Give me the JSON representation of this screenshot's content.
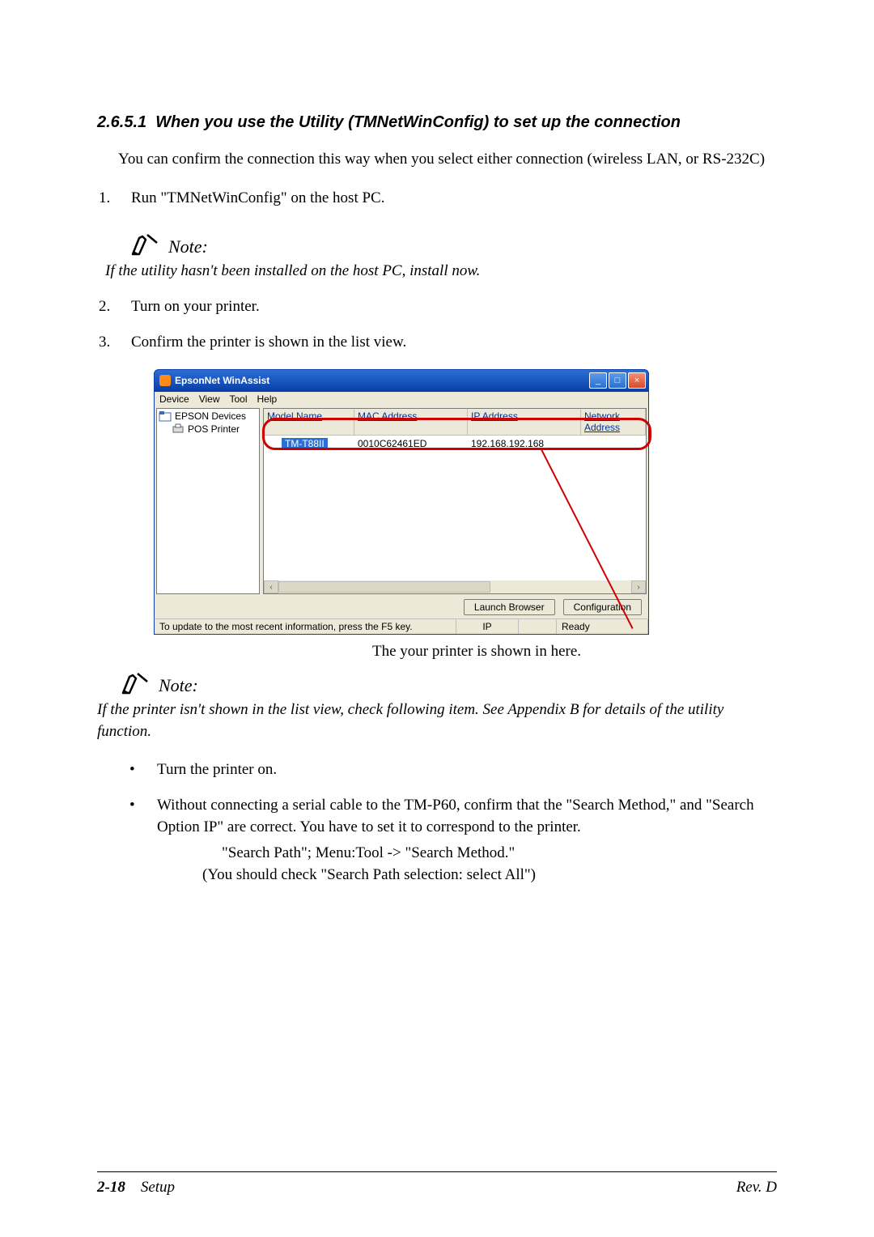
{
  "section": {
    "number": "2.6.5.1",
    "title": "When you use the Utility (TMNetWinConfig) to set up the connection"
  },
  "intro": "You can confirm  the connection this way when you select either connection (wireless LAN, or RS-232C)",
  "steps": {
    "s1": {
      "num": "1.",
      "text": "Run  \"TMNetWinConfig\" on the host PC."
    },
    "s2": {
      "num": "2.",
      "text": "Turn on your printer."
    },
    "s3": {
      "num": "3.",
      "text": "Confirm the printer is shown in the list view."
    }
  },
  "note1": {
    "label": "Note:",
    "text": "If the utility hasn't been installed on the host PC, install now."
  },
  "screenshot": {
    "title": "EpsonNet WinAssist",
    "menu": {
      "device": "Device",
      "view": "View",
      "tool": "Tool",
      "help": "Help"
    },
    "tree": {
      "root": "EPSON Devices",
      "child": "POS Printer"
    },
    "headers": {
      "model": "Model Name",
      "mac": "MAC Address",
      "ip": "IP Address",
      "net": "Network Address"
    },
    "row": {
      "model": "TM-T88II",
      "mac": "0010C62461ED",
      "ip": "192.168.192.168",
      "net": ""
    },
    "buttons": {
      "launch": "Launch Browser",
      "config": "Configuration"
    },
    "status": {
      "msg": "To update to the most recent information, press the F5 key.",
      "proto": "IP",
      "ready": "Ready"
    }
  },
  "caption": "The your printer is shown in here.",
  "note2": {
    "label": "Note:",
    "text": "If the printer isn't shown in the list view, check following item. See Appendix B for details of the utility function."
  },
  "bullets": {
    "b1": "Turn the printer on.",
    "b2": "Without connecting a serial cable to the TM-P60, confirm that the \"Search Method,\" and \"Search Option IP\" are correct. You have to set it to correspond to the printer.",
    "b2a": "\"Search Path\"; Menu:Tool -> \"Search Method.\"",
    "b2b": "(You should check \"Search Path selection: select All\")"
  },
  "footer": {
    "page": "2-18",
    "chapter": "Setup",
    "rev": "Rev. D"
  }
}
